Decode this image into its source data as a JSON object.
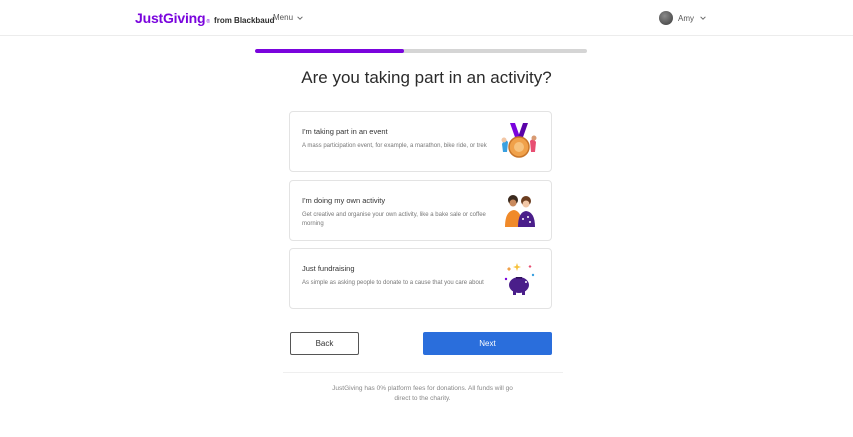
{
  "header": {
    "brand": "JustGiving",
    "brand_mark": "®",
    "brand_sub": "from Blackbaud",
    "menu_label": "Menu",
    "user_name": "Amy"
  },
  "progress": {
    "value": 0.45
  },
  "page": {
    "title": "Are you taking part in an activity?"
  },
  "options": [
    {
      "title": "I'm taking part in an event",
      "description": "A mass participation event, for example, a marathon, bike ride, or trek",
      "icon": "medal-icon"
    },
    {
      "title": "I'm doing my own activity",
      "description": "Get creative and organise your own activity, like a bake sale or coffee morning",
      "icon": "people-activity-icon"
    },
    {
      "title": "Just fundraising",
      "description": "As simple as asking people to donate to a cause that you care about",
      "icon": "piggy-bank-icon"
    }
  ],
  "actions": {
    "back_label": "Back",
    "next_label": "Next"
  },
  "footer": {
    "note": "JustGiving has 0% platform fees for donations. All funds will go direct to the charity."
  },
  "colors": {
    "brand": "#7a04dd",
    "primary_button": "#2a6edc",
    "progress_track": "#d5d5d5"
  }
}
